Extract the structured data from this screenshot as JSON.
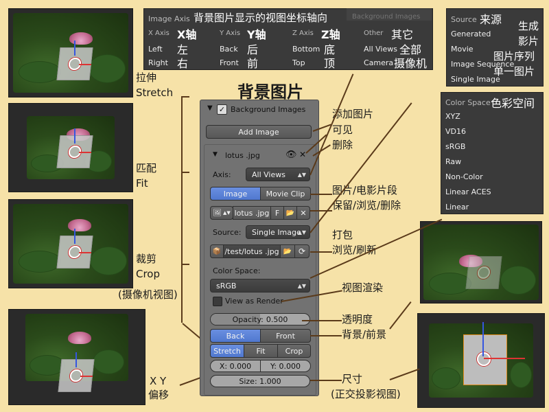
{
  "title_cn": "背景图片",
  "axis_box": {
    "header_en": "Image Axis",
    "header_cn": "背景图片显示的视图坐标轴向",
    "x_axis_en": "X Axis",
    "x_axis_cn": "X轴",
    "y_axis_en": "Y Axis",
    "y_axis_cn": "Y轴",
    "z_axis_en": "Z Axis",
    "z_axis_cn": "Z轴",
    "other_en": "Other",
    "other_cn": "其它",
    "left_en": "Left",
    "left_cn": "左",
    "right_en": "Right",
    "right_cn": "右",
    "back_en": "Back",
    "back_cn": "后",
    "front_en": "Front",
    "front_cn": "前",
    "bottom_en": "Bottom",
    "bottom_cn": "底",
    "top_en": "Top",
    "top_cn": "顶",
    "allviews_en": "All Views",
    "allviews_cn": "全部",
    "camera_en": "Camera",
    "camera_cn": "摄像机"
  },
  "source_box": {
    "header_en": "Source",
    "header_cn": "来源",
    "items": [
      {
        "en": "Generated",
        "cn": "生成"
      },
      {
        "en": "Movie",
        "cn": "影片"
      },
      {
        "en": "Image Sequence",
        "cn": "图片序列"
      },
      {
        "en": "Single Image",
        "cn": "单一图片"
      }
    ]
  },
  "colorspace_box": {
    "header_en": "Color Space",
    "header_cn": "色彩空间",
    "items": [
      "XYZ",
      "VD16",
      "sRGB",
      "Raw",
      "Non-Color",
      "Linear ACES",
      "Linear"
    ]
  },
  "left_labels": {
    "stretch_cn": "拉伸",
    "stretch_en": "Stretch",
    "fit_cn": "匹配",
    "fit_en": "Fit",
    "crop_cn": "裁剪",
    "crop_en": "Crop",
    "crop_note": "(摄像机视图)",
    "xy_cn": "X Y",
    "offset_cn": "偏移"
  },
  "panel": {
    "header": "Background Images",
    "add_image": "Add Image",
    "image_name": "lotus .jpg",
    "axis_label": "Axis:",
    "axis_value": "All Views",
    "tab_image": "Image",
    "tab_movie": "Movie Clip",
    "datablock_name": "lotus .jpg",
    "fake_user": "F",
    "source_label": "Source:",
    "source_value": "Single Image",
    "filepath": "/test/lotus .jpg",
    "colorspace_label": "Color Space:",
    "colorspace_value": "sRGB",
    "view_as_render": "View as Render",
    "opacity_label": "Opacity:",
    "opacity_value": "0.500",
    "opacity_fraction": 0.5,
    "back": "Back",
    "front": "Front",
    "stretch": "Stretch",
    "fit": "Fit",
    "crop": "Crop",
    "x_field": "X: 0.000",
    "y_field": "Y: 0.000",
    "size_field": "Size: 1.000"
  },
  "right_labels": {
    "add_image": "添加图片",
    "visible": "可见",
    "delete": "删除",
    "image_movie": "图片/电影片段",
    "keep_browse_delete": "保留/浏览/删除",
    "pack": "打包",
    "browse_refresh": "浏览/刷新",
    "view_render": "视图渲染",
    "opacity": "透明度",
    "back_front": "背景/前景",
    "size": "尺寸",
    "size_note": "(正交投影视图)"
  },
  "ghost_text": {
    "bg_header": "Background Images",
    "rows": [
      "Movie Clip",
      "lotus .jpg",
      "Single Image",
      "Single Image",
      "lotus .jpg"
    ]
  },
  "colors": {
    "background": "#f6e2a8",
    "panel": "#727272",
    "selected": "#5078cf",
    "connector": "#5a3a1a"
  }
}
